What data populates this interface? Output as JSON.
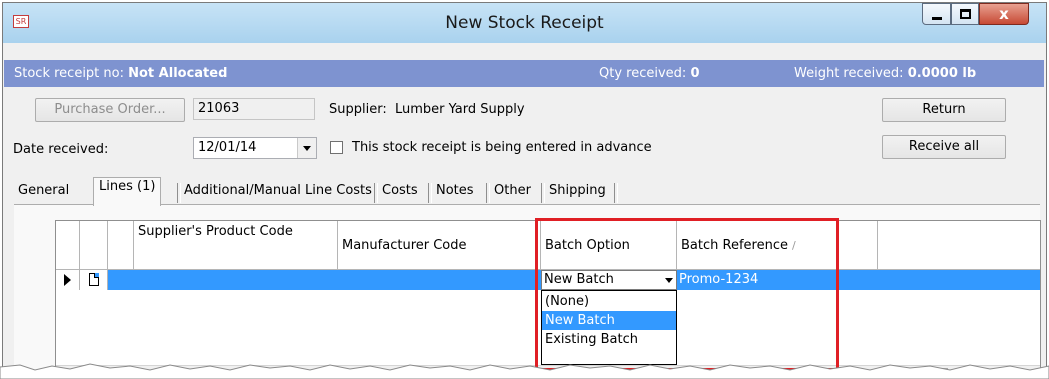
{
  "window": {
    "title": "New Stock Receipt",
    "icon_text": "SR"
  },
  "infobar": {
    "receipt_label": "Stock receipt no:",
    "receipt_value": "Not Allocated",
    "qty_label": "Qty received:",
    "qty_value": "0",
    "weight_label": "Weight received:",
    "weight_value": "0.0000 lb",
    "bg_color": "#7e93d0"
  },
  "form": {
    "purchase_order_button": "Purchase Order...",
    "purchase_order_value": "21063",
    "supplier_label": "Supplier:",
    "supplier_value": "Lumber Yard Supply",
    "date_label": "Date received:",
    "date_value": "12/01/14",
    "advance_checkbox_label": "This stock receipt is being entered in advance",
    "advance_checked": false,
    "return_button": "Return",
    "receive_all_button": "Receive all"
  },
  "tabs": [
    {
      "label": "General",
      "active": false
    },
    {
      "label": "Lines (1)",
      "active": true
    },
    {
      "label": "Additional/Manual Line Costs",
      "active": false
    },
    {
      "label": "Costs",
      "active": false
    },
    {
      "label": "Notes",
      "active": false
    },
    {
      "label": "Other",
      "active": false
    },
    {
      "label": "Shipping",
      "active": false
    }
  ],
  "grid": {
    "columns": [
      "Supplier's Product Code",
      "Manufacturer Code",
      "Batch Option",
      "Batch Reference"
    ],
    "sort_glyph": "/",
    "rows": [
      {
        "supplier_code": "",
        "manufacturer_code": "",
        "batch_option": "New Batch",
        "batch_reference": "Promo-1234"
      }
    ],
    "batch_options": [
      "(None)",
      "New Batch",
      "Existing Batch"
    ],
    "selected_option": "New Batch",
    "selection_color": "#3399ff",
    "highlight_color": "#e01f25"
  }
}
